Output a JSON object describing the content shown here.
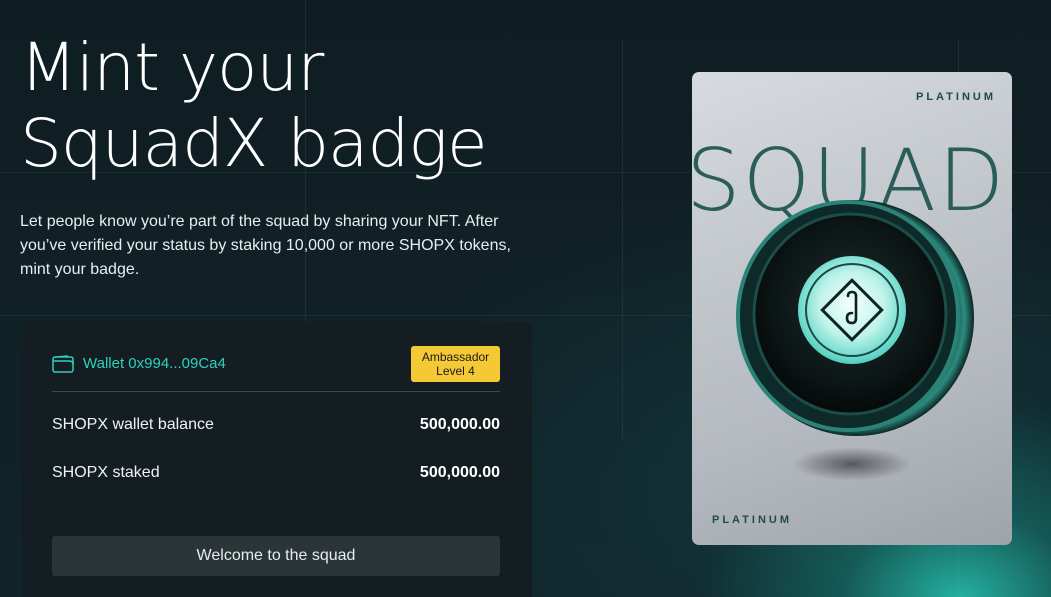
{
  "hero": {
    "title_line1": "Mint your",
    "title_line2": "SquadX badge",
    "description": "Let people know you’re part of the squad by sharing your NFT. After you’ve verified your status by staking 10,000 or more SHOPX tokens, mint your badge."
  },
  "wallet": {
    "icon": "wallet-icon",
    "label": "Wallet 0x994...09Ca4",
    "badge_line1": "Ambassador",
    "badge_line2": "Level 4",
    "badge_color": "#f5c935",
    "accent_color": "#2fd1be"
  },
  "stats": [
    {
      "label": "SHOPX wallet balance",
      "value": "500,000.00"
    },
    {
      "label": "SHOPX staked",
      "value": "500,000.00"
    }
  ],
  "cta": {
    "label": "Welcome to the squad"
  },
  "card": {
    "tier_top": "PLATINUM",
    "brand": "SQUADX",
    "tier_bottom": "PLATINUM",
    "coin_icon": "squadx-logo-icon"
  }
}
